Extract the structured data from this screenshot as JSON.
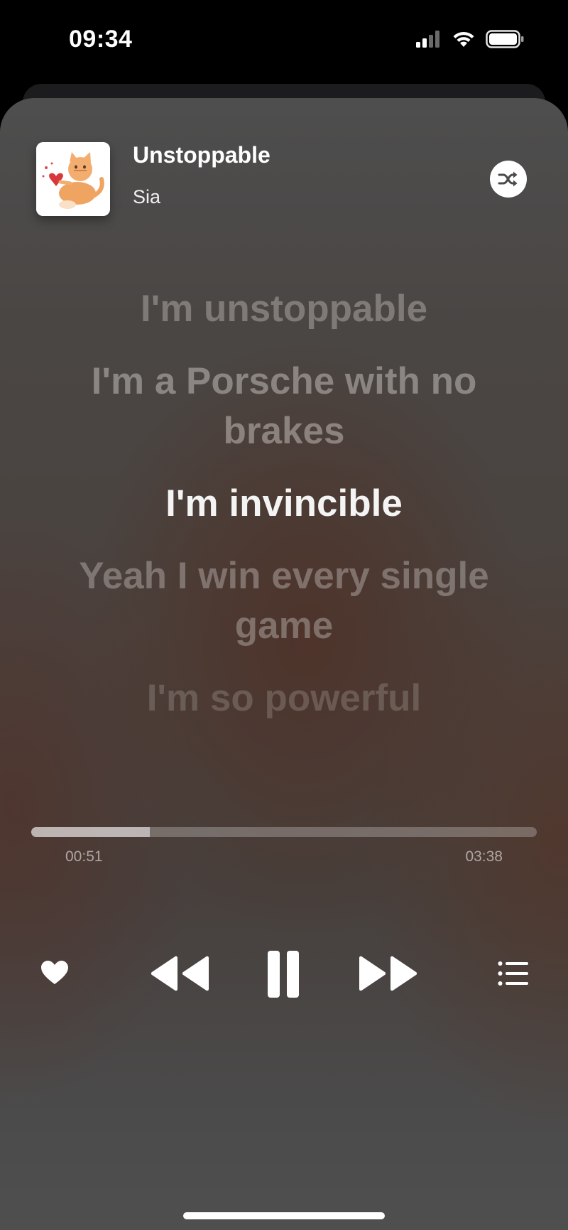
{
  "status_bar": {
    "time": "09:34"
  },
  "now_playing": {
    "title": "Unstoppable",
    "artist": "Sia"
  },
  "lyrics": [
    {
      "text": "I'm unstoppable",
      "state": "past"
    },
    {
      "text": "I'm a Porsche with no brakes",
      "state": "past"
    },
    {
      "text": "I'm invincible",
      "state": "current"
    },
    {
      "text": "Yeah I win every single game",
      "state": "upcoming"
    },
    {
      "text": "I'm so powerful",
      "state": "upcoming"
    }
  ],
  "playback": {
    "elapsed": "00:51",
    "total": "03:38",
    "progress": 0.235
  },
  "controls": [
    "heart-icon",
    "rewind-icon",
    "pause-icon",
    "forward-icon",
    "queue-list-icon"
  ],
  "icons": {
    "shuffle": "shuffle-icon",
    "signal": "signal-icon",
    "wifi": "wifi-icon",
    "battery": "battery-icon"
  }
}
